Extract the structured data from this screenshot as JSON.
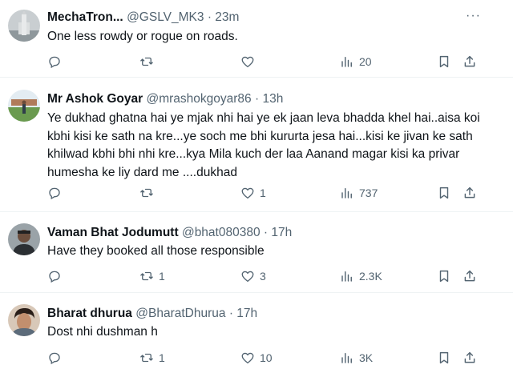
{
  "tweets": [
    {
      "name": "MechaTron...",
      "handle": "@GSLV_MK3",
      "separator": "·",
      "time": "23m",
      "text": "One less rowdy or rogue on roads.",
      "replies": "",
      "retweets": "",
      "likes": "",
      "views": "20",
      "avatar_icon": "rocket-avatar-icon"
    },
    {
      "name": "Mr Ashok Goyar",
      "handle": "@mrashokgoyar86",
      "separator": "·",
      "time": "13h",
      "text": "Ye dukhad ghatna hai ye mjak nhi hai ye ek jaan leva bhadda khel hai..aisa koi kbhi kisi ke sath na kre...ye soch me bhi kururta jesa hai...kisi ke jivan ke sath khilwad kbhi bhi nhi kre...kya Mila kuch der laa Aanand magar kisi ka privar humesha ke liy dard me ....dukhad",
      "replies": "",
      "retweets": "",
      "likes": "1",
      "views": "737",
      "avatar_icon": "landscape-avatar-icon"
    },
    {
      "name": "Vaman Bhat Jodumutt",
      "handle": "@bhat080380",
      "separator": "·",
      "time": "17h",
      "text": "Have they booked all those responsible",
      "replies": "",
      "retweets": "1",
      "likes": "3",
      "views": "2.3K",
      "avatar_icon": "person-avatar-icon"
    },
    {
      "name": "Bharat dhurua",
      "handle": "@BharatDhurua",
      "separator": "·",
      "time": "17h",
      "text": "Dost nhi dushman h",
      "replies": "",
      "retweets": "1",
      "likes": "10",
      "views": "3K",
      "avatar_icon": "face-avatar-icon"
    }
  ],
  "more_label": "···",
  "colors": {
    "text_primary": "#0f1419",
    "text_secondary": "#536471",
    "divider": "#eff3f4"
  }
}
